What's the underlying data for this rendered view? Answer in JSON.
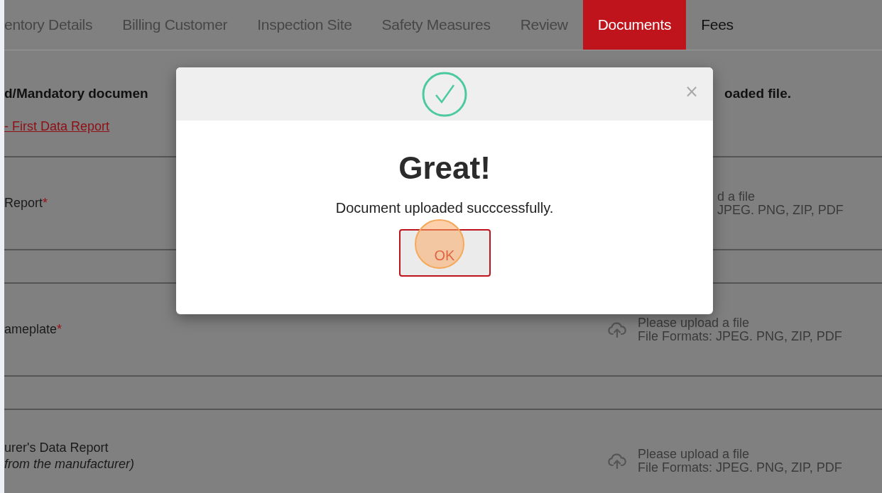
{
  "tabs": [
    {
      "label": "entory Details",
      "selected": false,
      "disabled": true
    },
    {
      "label": "Billing Customer",
      "selected": false,
      "disabled": true
    },
    {
      "label": "Inspection Site",
      "selected": false,
      "disabled": true
    },
    {
      "label": "Safety Measures",
      "selected": false,
      "disabled": true
    },
    {
      "label": "Review",
      "selected": false,
      "disabled": true
    },
    {
      "label": "Documents",
      "selected": true,
      "disabled": false
    },
    {
      "label": "Fees",
      "selected": false,
      "disabled": false
    }
  ],
  "instructions": {
    "text_left": "d/Mandatory documen",
    "text_right": "oaded file.",
    "link": "- First Data Report"
  },
  "documents": [
    {
      "kind": "partial",
      "label": "Report",
      "required_mark": "*",
      "upload_title": "d a file",
      "upload_formats": "JPEG. PNG, ZIP, PDF"
    },
    {
      "kind": "full",
      "label": "ameplate",
      "required_mark": "*",
      "upload_title": "Please upload a file",
      "upload_formats": "File Formats: JPEG. PNG, ZIP, PDF"
    },
    {
      "kind": "full",
      "label": "urer's Data Report",
      "note": "from the manufacturer)",
      "upload_title": "Please upload a file",
      "upload_formats": "File Formats: JPEG. PNG, ZIP, PDF"
    }
  ],
  "modal": {
    "close": "×",
    "title": "Great!",
    "message": "Document uploaded succcessfully.",
    "button": "OK"
  }
}
